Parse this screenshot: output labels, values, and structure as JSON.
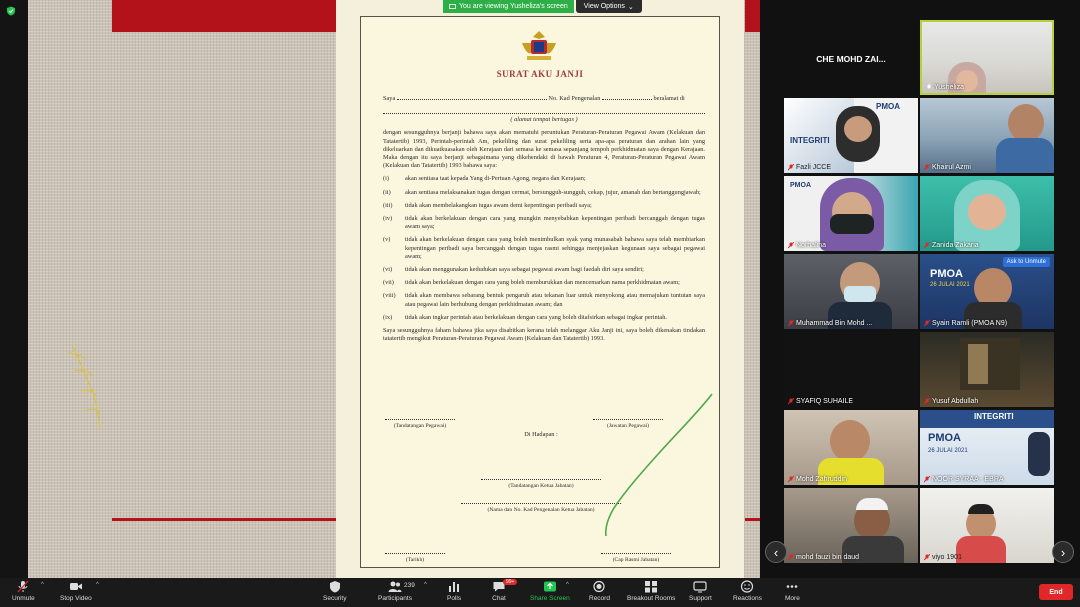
{
  "banner": {
    "viewing_text": "You are viewing Yusheliza's screen",
    "options_label": "View Options"
  },
  "document": {
    "title": "SURAT AKU JANJI",
    "saya": "Saya",
    "kad_label": "No. Kad Pengenalan",
    "beralamat": "beralamat di",
    "alamat": "( alamat tempat bertugas )",
    "intro": "dengan sesungguhnya berjanji bahawa saya akan mematuhi peruntukan Peraturan-Peraturan Pegawai Awam (Kelakuan dan Tatatertib) 1993, Perintah-perintah Am, pekeliling dan surat pekeliling serta apa-apa peraturan dan arahan lain yang dikeluarkan dan dikuatkuasakan oleh Kerajaan dari semasa ke semasa sepanjang tempoh perkhidmatan saya dengan Kerajaan. Maka dengan itu saya berjanji sebagaimana yang dikehendaki di bawah Peraturan 4, Peraturan-Peraturan Pegawai Awam (Kelakuan dan Tatatertib) 1993 bahawa saya:",
    "clauses": [
      {
        "num": "(i)",
        "text": "akan sentiasa taat kepada Yang di-Pertuan Agong, negara dan Kerajaan;"
      },
      {
        "num": "(ii)",
        "text": "akan sentiasa melaksanakan tugas dengan cermat, bersungguh-sungguh, cekap, jujur, amanah dan bertanggungjawab;"
      },
      {
        "num": "(iii)",
        "text": "tidak akan membelakangkan tugas awam demi kepentingan peribadi saya;"
      },
      {
        "num": "(iv)",
        "text": "tidak akan berkelakuan dengan cara yang mungkin menyebabkan kepentingan peribadi bercanggah dengan tugas awam saya;"
      },
      {
        "num": "(v)",
        "text": "tidak akan berkelakuan dengan cara yang boleh menimbulkan syak yang munasabah bahawa saya telah membiarkan kepentingan peribadi saya bercanggah dengan tugas rasmi sehingga menjejaskan kegunaan saya sebagai pegawai awam;"
      },
      {
        "num": "(vi)",
        "text": "tidak akan menggunakan kedudukan saya sebagai pegawai awam bagi faedah diri saya sendiri;"
      },
      {
        "num": "(vii)",
        "text": "tidak akan berkelakuan dengan cara yang boleh memburukkan dan mencemarkan nama perkhidmatan awam;"
      },
      {
        "num": "(viii)",
        "text": "tidak akan membawa sebarang bentuk pengaruh atau tekanan luar untuk menyokong atau memajukan tuntutan saya atau pegawai lain berhubung dengan perkhidmatan awam; dan"
      },
      {
        "num": "(ix)",
        "text": "tidak akan ingkar perintah atau berkelakuan dengan cara yang boleh ditafsirkan sebagai ingkar perintah."
      }
    ],
    "closing": "Saya sesungguhnya faham bahawa jika saya disabitkan kerana telah melanggar Aku Janji ini, saya boleh dikenakan tindakan tatatertib mengikut Peraturan-Peraturan Pegawai Awam (Kelakuan dan Tatatertib) 1993.",
    "tandatangan_pegawai": "(Tandatangan Pegawai)",
    "jawatan_pegawai": "(Jawatan Pegawai)",
    "di_hadapan": "Di Hadapan :",
    "tandatangan_ketua": "(Tandatangan Ketua Jabatan)",
    "nama_ketua": "(Nama dan No. Kad Pengenalan Ketua Jabatan)",
    "tarikh": "(Tarikh)",
    "cap_rasmi": "(Cap Rasmi Jabatan)"
  },
  "gallery": {
    "participants": [
      {
        "name": "CHE MOHD ZAI...",
        "name_only": true
      },
      {
        "name": "Yusheliza"
      },
      {
        "name": "Fazli JCCE"
      },
      {
        "name": "Khairul Azmi"
      },
      {
        "name": "Norhalina"
      },
      {
        "name": "Zanida Zakaria"
      },
      {
        "name": "Muhammad Bin Mohd ..."
      },
      {
        "name": "Syain Ramli (PMOA N9)"
      },
      {
        "name": "SYAFIQ SUHAILE"
      },
      {
        "name": "Yusuf Abdullah"
      },
      {
        "name": "Mohd Zahruddin"
      },
      {
        "name": "NOOR SYRAA - EBRA"
      },
      {
        "name": "mohd fauzi bin daud"
      },
      {
        "name": "viyo 1901"
      }
    ],
    "ask_to_unmute": "Ask to Unmute",
    "tile_texts": {
      "integriti": "INTEGRITI",
      "pmoa": "PMOA",
      "date": "26 JULAI 2021"
    }
  },
  "toolbar": {
    "unmute": "Unmute",
    "stop_video": "Stop Video",
    "security": "Security",
    "participants": "Participants",
    "participants_count": "239",
    "polls": "Polls",
    "chat": "Chat",
    "chat_badge": "99+",
    "share_screen": "Share Screen",
    "record": "Record",
    "breakout_rooms": "Breakout Rooms",
    "support": "Support",
    "reactions": "Reactions",
    "more": "More",
    "end": "End"
  },
  "colors": {
    "share_green": "#23c552",
    "end_red": "#e02828",
    "speaker_border": "#b6d13b",
    "banner_green": "#2eae47"
  }
}
